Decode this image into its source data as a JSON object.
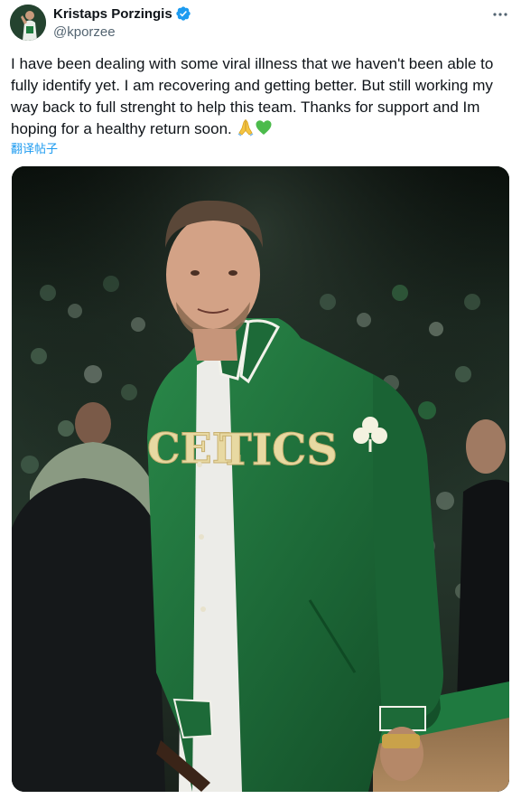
{
  "author": {
    "display_name": "Kristaps Porzingis",
    "handle": "@kporzee",
    "verified": true
  },
  "icons": {
    "verified": "verified-badge-icon",
    "more": "more-options-icon",
    "emoji_1": "folded-hands-emoji",
    "emoji_2": "green-heart-emoji"
  },
  "post": {
    "text": "I have been dealing with some viral illness that we haven't been able to fully identify yet. I am recovering and getting better. But still working my way back to full strenght to help this team. Thanks for support and Im hoping for a healthy return soon. ",
    "translate_label": "翻译帖子"
  },
  "media": {
    "jacket_text_left": "CEL",
    "jacket_text_right": "TICS"
  },
  "colors": {
    "link": "#1d9bf0",
    "text": "#0f1419",
    "secondary": "#536471",
    "jacket_green": "#1f6b3a",
    "lettering_gold": "#e8d9a2"
  }
}
